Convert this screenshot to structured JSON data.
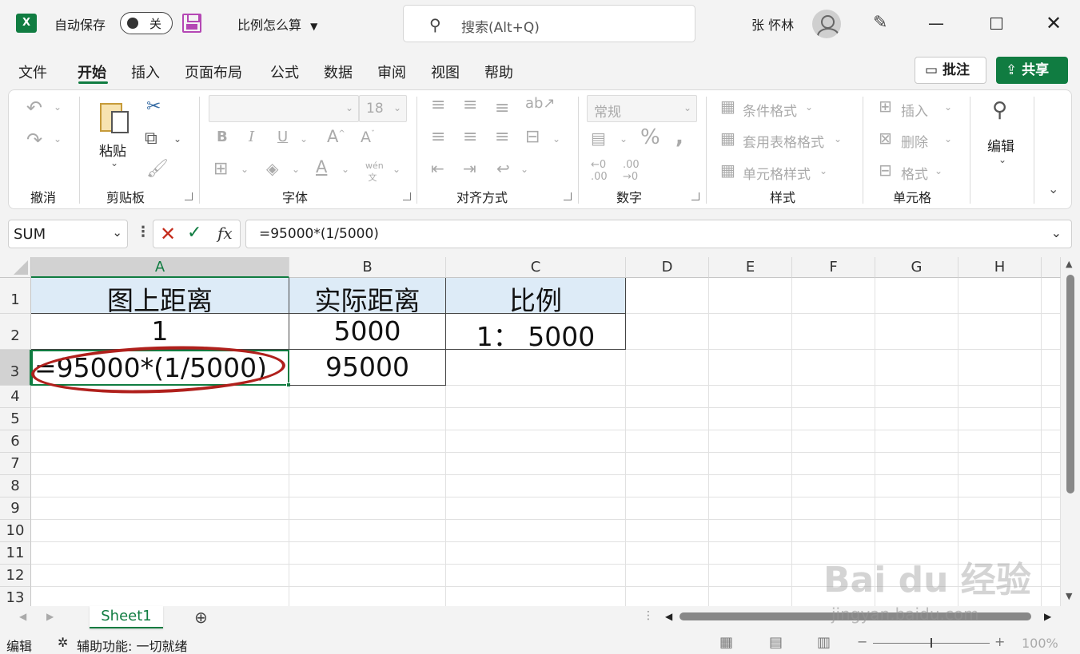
{
  "titlebar": {
    "app_icon": "X",
    "autosave_label": "自动保存",
    "autosave_state": "关",
    "doc_name": "比例怎么算",
    "search_placeholder": "搜索(Alt+Q)",
    "user_name": "张 怀林"
  },
  "menu": {
    "tabs": [
      "文件",
      "开始",
      "插入",
      "页面布局",
      "公式",
      "数据",
      "审阅",
      "视图",
      "帮助"
    ],
    "comment_label": "批注",
    "share_label": "共享"
  },
  "ribbon": {
    "groups": [
      "撤消",
      "剪贴板",
      "字体",
      "对齐方式",
      "数字",
      "样式",
      "单元格"
    ],
    "paste_label": "粘贴",
    "font_size": "18",
    "number_format": "常规",
    "styles": [
      "条件格式",
      "套用表格格式",
      "单元格样式"
    ],
    "cells": [
      "插入",
      "删除",
      "格式"
    ],
    "edit_label": "编辑"
  },
  "formula_bar": {
    "name_box": "SUM",
    "formula": "=95000*(1/5000)"
  },
  "grid": {
    "columns": [
      "A",
      "B",
      "C",
      "D",
      "E",
      "F",
      "G",
      "H"
    ],
    "rows": [
      "1",
      "2",
      "3",
      "4",
      "5",
      "6",
      "7",
      "8",
      "9",
      "10",
      "11",
      "12",
      "13"
    ],
    "cells": {
      "A1": "图上距离",
      "B1": "实际距离",
      "C1": "比例",
      "A2": "1",
      "B2": "5000",
      "C2": "1：  5000",
      "A3": "=95000*(1/5000)",
      "B3": "95000"
    }
  },
  "sheet_tabs": [
    "Sheet1"
  ],
  "status": {
    "mode": "编辑",
    "accessibility": "辅助功能: 一切就绪",
    "zoom": "100%"
  },
  "watermark": {
    "logo": "Bai du 经验",
    "url": "jingyan.baidu.com"
  }
}
